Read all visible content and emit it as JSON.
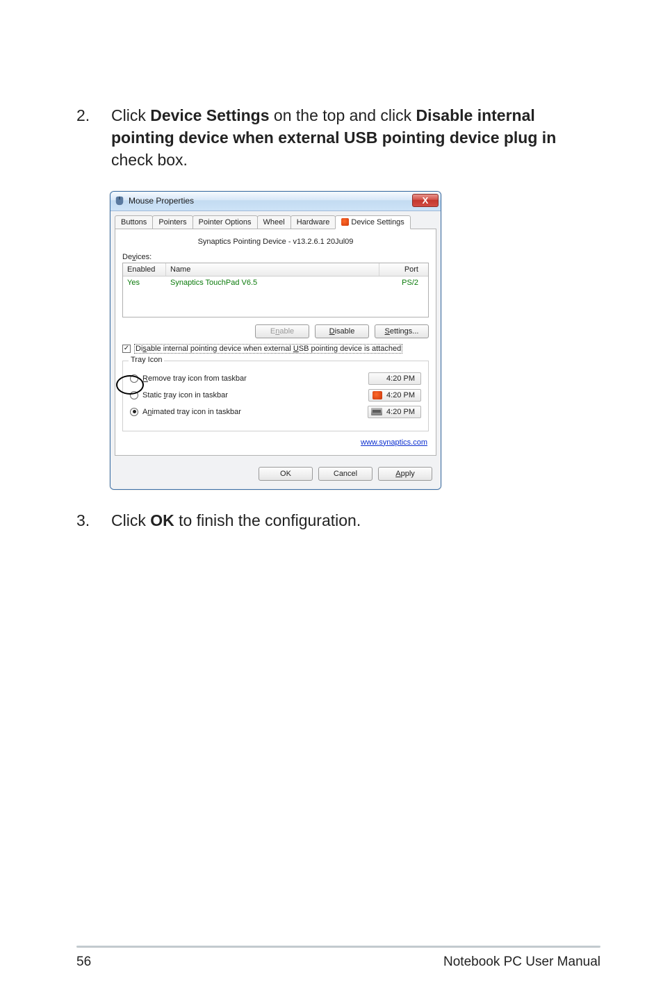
{
  "steps": [
    {
      "num": "2.",
      "pre": "Click ",
      "bold1": "Device Settings",
      "mid": " on the top and click ",
      "bold2": "Disable internal pointing device when external USB pointing device plug in",
      "post": " check box."
    },
    {
      "num": "3.",
      "pre": "Click ",
      "bold1": "OK",
      "mid": " to finish the configuration.",
      "bold2": "",
      "post": ""
    }
  ],
  "dialog": {
    "title": "Mouse Properties",
    "close_label": "X",
    "tabs": [
      "Buttons",
      "Pointers",
      "Pointer Options",
      "Wheel",
      "Hardware",
      "Device Settings"
    ],
    "active_tab_index": 5,
    "driver_line": "Synaptics Pointing Device - v13.2.6.1 20Jul09",
    "devices_label_pre": "De",
    "devices_label_u": "v",
    "devices_label_post": "ices:",
    "columns": {
      "enabled": "Enabled",
      "name": "Name",
      "port": "Port"
    },
    "row": {
      "enabled": "Yes",
      "name": "Synaptics TouchPad V6.5",
      "port": "PS/2"
    },
    "buttons": {
      "enable_pre": "E",
      "enable_u": "n",
      "enable_post": "able",
      "disable_u": "D",
      "disable_post": "isable",
      "settings_u": "S",
      "settings_post": "ettings..."
    },
    "checkbox": {
      "pre": "Di",
      "u": "s",
      "mid": "able internal pointing device when external ",
      "u2": "U",
      "post": "SB pointing device is attached"
    },
    "tray": {
      "legend": "Tray Icon",
      "remove_u": "R",
      "remove_post": "emove tray icon from taskbar",
      "static_pre": "Static ",
      "static_u": "t",
      "static_post": "ray icon in taskbar",
      "animated_pre": "A",
      "animated_u": "n",
      "animated_post": "imated tray icon in taskbar",
      "time1": "4:20 PM",
      "time2": "4:20 PM",
      "time3": "4:20 PM",
      "selected_index": 2
    },
    "link_text": "www.synaptics.com",
    "dlg_buttons": {
      "ok": "OK",
      "cancel": "Cancel",
      "apply_u": "A",
      "apply_post": "pply"
    }
  },
  "footer": {
    "page": "56",
    "manual": "Notebook PC User Manual"
  }
}
